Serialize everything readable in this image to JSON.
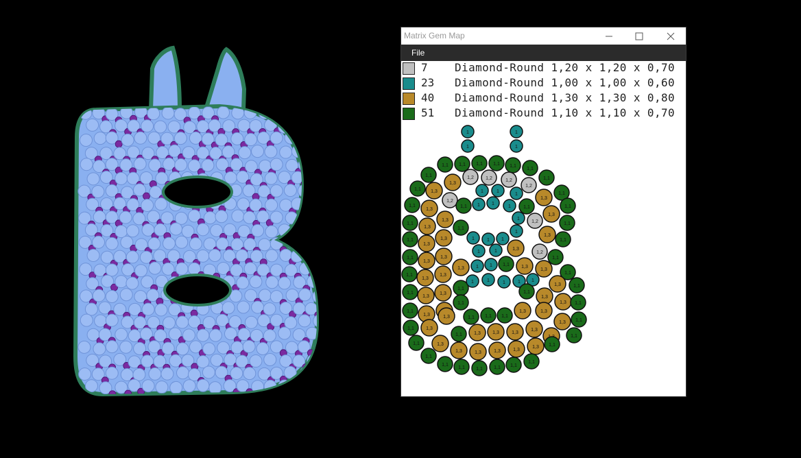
{
  "window": {
    "title": "Matrix Gem Map",
    "minimize_icon": "minimize-icon",
    "maximize_icon": "maximize-icon",
    "close_icon": "close-icon"
  },
  "menu": {
    "file": "File"
  },
  "legend": [
    {
      "count": "7",
      "desc": "Diamond-Round 1,20 x 1,20 x 0,70",
      "color": "#c0c0c0"
    },
    {
      "count": "23",
      "desc": "Diamond-Round 1,00 x 1,00 x 0,60",
      "color": "#1a8c8c"
    },
    {
      "count": "40",
      "desc": "Diamond-Round 1,30 x 1,30 x 0,80",
      "color": "#b8892a"
    },
    {
      "count": "51",
      "desc": "Diamond-Round 1,10 x 1,10 x 0,70",
      "color": "#1a6b1a"
    }
  ],
  "gem_labels": {
    "gray": "1,2",
    "teal": "1",
    "gold": "1,3",
    "green": "1,1"
  },
  "colors": {
    "background": "#000000",
    "viewport_fill": "#8ab0f0",
    "viewport_outline": "#2e7d5a",
    "viewport_gem": "#7a2aa0"
  }
}
